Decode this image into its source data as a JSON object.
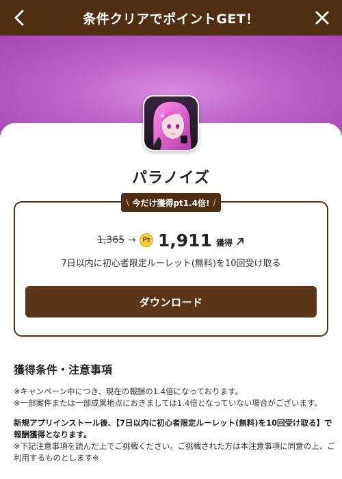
{
  "header": {
    "title": "条件クリアでポイントGET！"
  },
  "app": {
    "name": "パラノイズ"
  },
  "offer": {
    "badge_text": "今だけ獲得pt1.4倍!",
    "old_points": "1,365",
    "pt_icon_label": "Pt",
    "new_points": "1,911",
    "earn_label": "獲得",
    "condition": "7日以内に初心者限定ルーレット(無料)を10回受け取る",
    "download_label": "ダウンロード"
  },
  "notes": {
    "title": "獲得条件・注意事項",
    "line1": "※キャンペーン中につき、現在の報酬の1.4倍になっております。",
    "line2": "※一部案件または一部成果地点におきましては1.4倍となっていない場合がございます。",
    "line3": "新規アプリインストール後、【7日以内に初心者限定ルーレット(無料)を10回受け取る】で報酬獲得となります。",
    "line4": "※下記注意事項を読んだ上でご挑戦ください。ご挑戦された方は本注意事項に同意の上、ご利用するものとします※"
  },
  "colors": {
    "brand_brown": "#4f2e12",
    "button_brown": "#5a3518",
    "hero_purple": "#bd62c8",
    "pt_gold": "#f3cf3a"
  },
  "icons": {
    "back": "chevron-left-icon",
    "close": "close-icon",
    "points": "pt-coin-icon",
    "external": "arrow-up-right-icon"
  }
}
